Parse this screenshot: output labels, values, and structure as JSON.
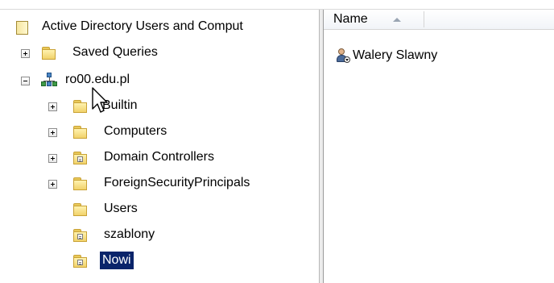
{
  "tree": {
    "root_label": "Active Directory Users and Comput",
    "saved_queries_label": "Saved Queries",
    "domain_label": "ro00.edu.pl",
    "children": [
      {
        "label": "Builtin",
        "expander": "+",
        "type": "container"
      },
      {
        "label": "Computers",
        "expander": "+",
        "type": "container"
      },
      {
        "label": "Domain Controllers",
        "expander": "+",
        "type": "organizational-unit"
      },
      {
        "label": "ForeignSecurityPrincipals",
        "expander": "+",
        "type": "container"
      },
      {
        "label": "Users",
        "expander": "",
        "type": "container"
      },
      {
        "label": "szablony",
        "expander": "",
        "type": "organizational-unit"
      },
      {
        "label": "Nowi",
        "expander": "",
        "type": "organizational-unit",
        "selected": true
      }
    ]
  },
  "list": {
    "column_name": "Name",
    "sort": "ascending",
    "items": [
      {
        "name": "Walery Slawny",
        "icon": "user-disabled-icon"
      }
    ]
  },
  "colors": {
    "selection_bg": "#0a246a",
    "selection_fg": "#ffffff",
    "folder": "#f1d26a"
  },
  "icons": {
    "root": "snapin-console-icon",
    "domain": "domain-icon",
    "folder": "folder-icon",
    "ou": "organizational-unit-icon",
    "user": "user-icon"
  }
}
